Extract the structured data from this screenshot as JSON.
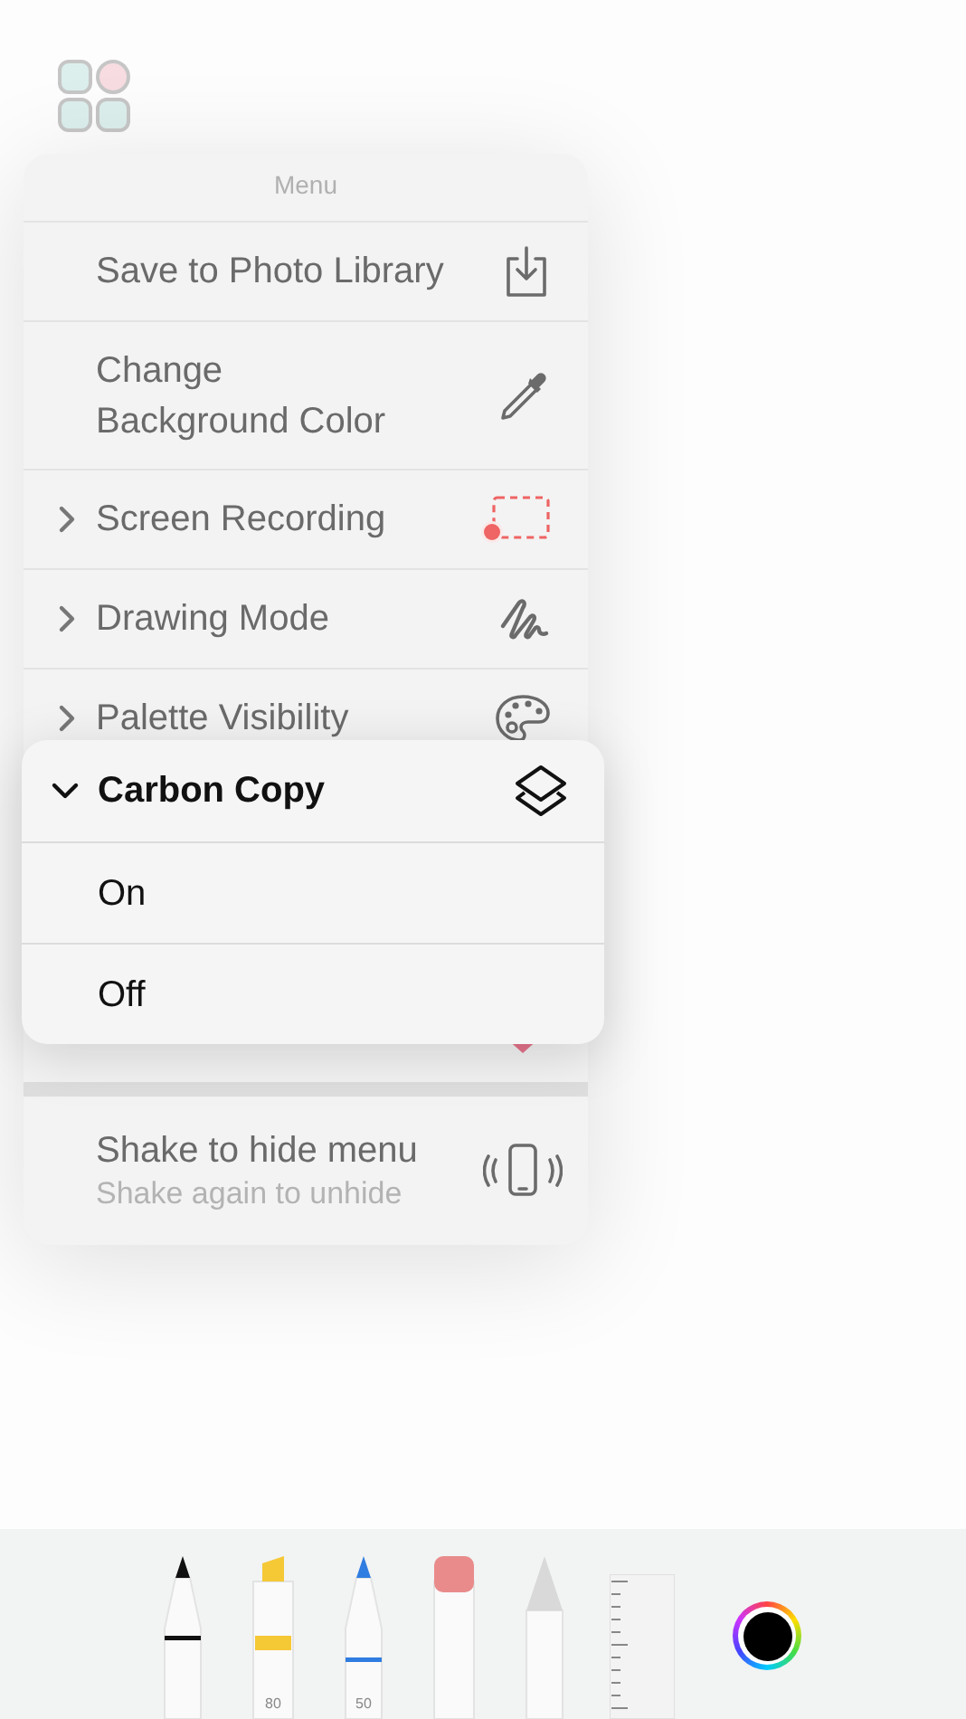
{
  "menu": {
    "title": "Menu",
    "items": [
      {
        "kind": "action",
        "label": "Save to Photo Library"
      },
      {
        "kind": "action",
        "label": "Change Background Color"
      },
      {
        "kind": "submenu",
        "label": "Screen Recording",
        "expanded": false
      },
      {
        "kind": "submenu",
        "label": "Drawing Mode",
        "expanded": false
      },
      {
        "kind": "submenu",
        "label": "Palette Visibility",
        "expanded": false
      },
      {
        "kind": "covered"
      }
    ],
    "footer": {
      "label": "Shake to hide menu",
      "sublabel": "Shake again to unhide"
    }
  },
  "popover": {
    "label": "Carbon Copy",
    "expanded": true,
    "options": [
      {
        "label": "On"
      },
      {
        "label": "Off"
      }
    ]
  },
  "tools": [
    {
      "kind": "pen"
    },
    {
      "kind": "highlighter",
      "color": "#f5c836",
      "label": "80"
    },
    {
      "kind": "marker",
      "color": "#2f7de1",
      "label": "50"
    },
    {
      "kind": "eraser"
    },
    {
      "kind": "pencil"
    },
    {
      "kind": "ruler"
    }
  ]
}
